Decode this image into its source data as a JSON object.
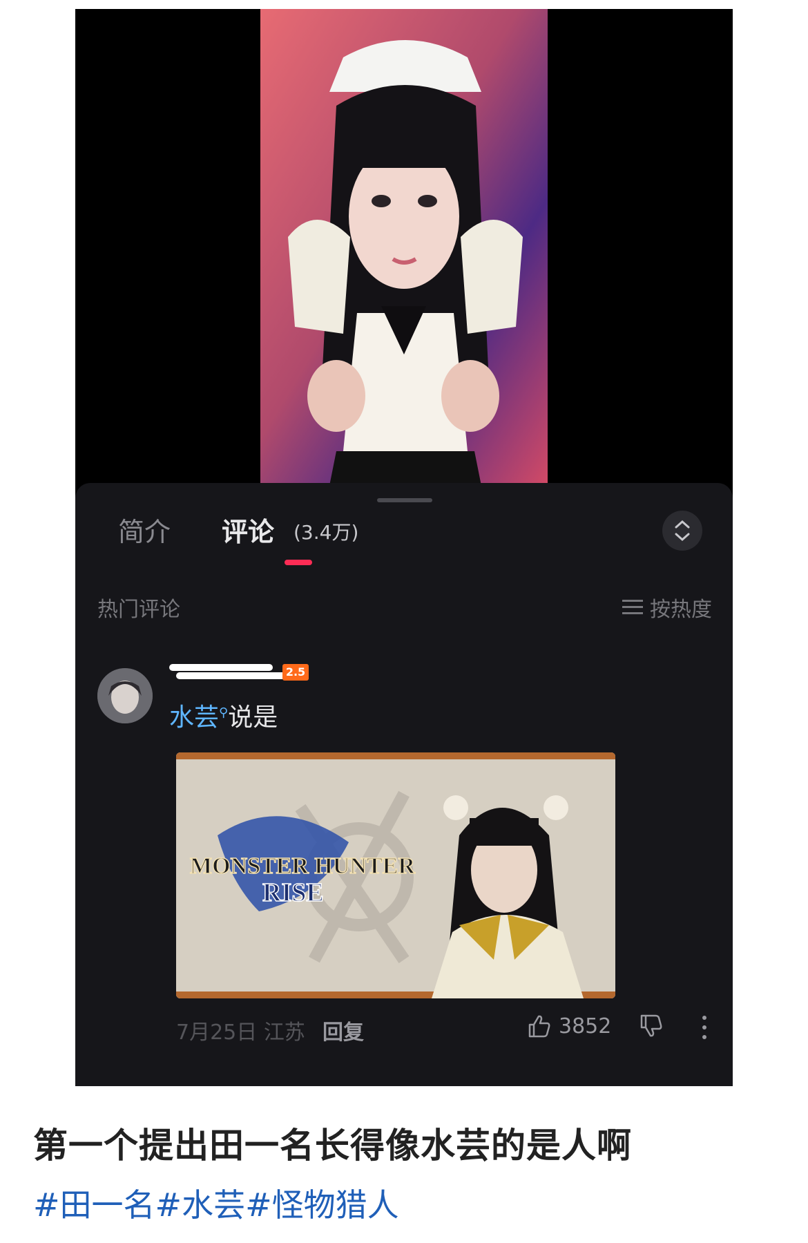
{
  "comments_panel": {
    "tabs": [
      {
        "label": "简介"
      },
      {
        "label": "评论",
        "count": "(3.4万)"
      }
    ],
    "section_title": "热门评论",
    "sort_label": "按热度"
  },
  "comment": {
    "username_badge": "2.5",
    "mention": "水芸",
    "text": "说是",
    "image_logo_line1": "MONSTER HUNTER",
    "image_logo_line2": "RISE",
    "date": "7月25日",
    "location": "江苏",
    "reply_label": "回复",
    "like_count": "3852"
  },
  "post": {
    "caption": "第一个提出田一名长得像水芸的是人啊",
    "hashtags": "#田一名#水芸#怪物猎人"
  },
  "colors": {
    "accent": "#fe2c55",
    "mention": "#5fb6ff",
    "hashtag": "#1f5fb8"
  }
}
